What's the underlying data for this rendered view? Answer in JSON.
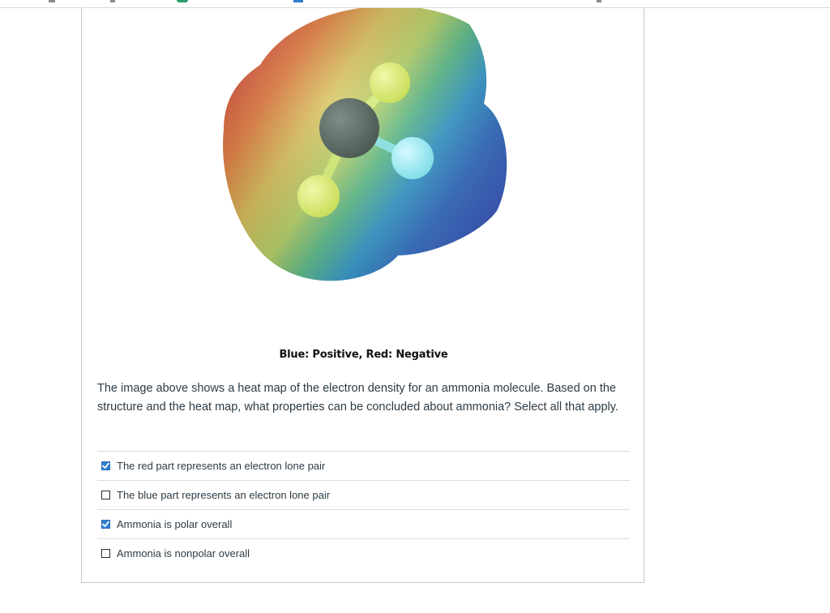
{
  "caption": "Blue: Positive, Red: Negative",
  "question": "The image above shows a heat map of the electron density for an ammonia molecule. Based on the structure and the heat map, what properties can be concluded about ammonia? Select all that apply.",
  "options": [
    {
      "label": "The red part represents an electron lone pair",
      "checked": true
    },
    {
      "label": "The blue part represents an electron lone pair",
      "checked": false
    },
    {
      "label": "Ammonia is polar overall",
      "checked": true
    },
    {
      "label": "Ammonia is nonpolar overall",
      "checked": false
    }
  ],
  "colors": {
    "check_fill": "#2f7fd1",
    "text": "#2d3b45",
    "divider": "#d9dde0"
  }
}
